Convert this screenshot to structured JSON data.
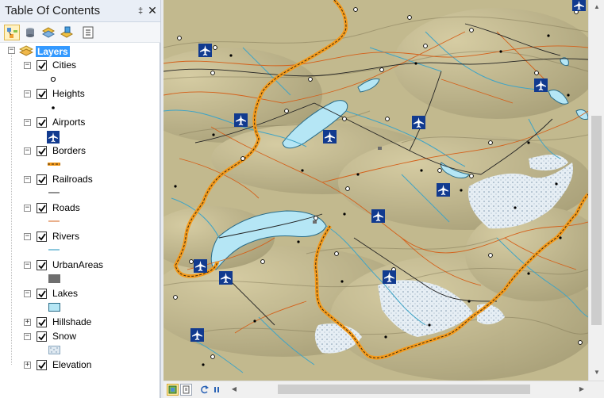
{
  "toc": {
    "title": "Table Of Contents",
    "pin_glyph": "‡",
    "close_glyph": "✕",
    "toolbar": [
      {
        "name": "list-by-drawing-order-icon",
        "active": true
      },
      {
        "name": "list-by-source-icon",
        "active": false
      },
      {
        "name": "list-by-visibility-icon",
        "active": false
      },
      {
        "name": "list-by-selection-icon",
        "active": false
      },
      {
        "name": "options-icon",
        "active": false
      }
    ],
    "root": {
      "label": "Layers",
      "expander": "−"
    },
    "layers": [
      {
        "label": "Cities",
        "expander": "−",
        "checked": true,
        "expanded": true,
        "symbol": "city-point-icon"
      },
      {
        "label": "Heights",
        "expander": "−",
        "checked": true,
        "expanded": true,
        "symbol": "height-point-icon"
      },
      {
        "label": "Airports",
        "expander": "−",
        "checked": true,
        "expanded": true,
        "symbol": "airport-icon"
      },
      {
        "label": "Borders",
        "expander": "−",
        "checked": true,
        "expanded": true,
        "symbol": "border-line-icon"
      },
      {
        "label": "Railroads",
        "expander": "−",
        "checked": true,
        "expanded": true,
        "symbol": "railroad-line-icon"
      },
      {
        "label": "Roads",
        "expander": "−",
        "checked": true,
        "expanded": true,
        "symbol": "road-line-icon"
      },
      {
        "label": "Rivers",
        "expander": "−",
        "checked": true,
        "expanded": true,
        "symbol": "river-line-icon"
      },
      {
        "label": "UrbanAreas",
        "expander": "−",
        "checked": true,
        "expanded": true,
        "symbol": "urban-area-fill-icon"
      },
      {
        "label": "Lakes",
        "expander": "−",
        "checked": true,
        "expanded": true,
        "symbol": "lake-fill-icon"
      },
      {
        "label": "Hillshade",
        "expander": "+",
        "checked": true,
        "expanded": false,
        "symbol": ""
      },
      {
        "label": "Snow",
        "expander": "−",
        "checked": true,
        "expanded": true,
        "symbol": "snow-fill-icon"
      },
      {
        "label": "Elevation",
        "expander": "+",
        "checked": true,
        "expanded": false,
        "symbol": ""
      }
    ]
  },
  "colors": {
    "selection": "#3399ff",
    "border": "#f59a1a",
    "border_dark": "#3a2a10",
    "road": "#d4601a",
    "railroad": "#222222",
    "river": "#3fa4c6",
    "lake": "#b5e6f5",
    "urban": "#6e6e6e",
    "snow": "#dfe9f1",
    "airport_bg": "#113a8f",
    "terrain": "#c2b98e"
  },
  "view_buttons": [
    {
      "name": "data-view-button",
      "active": true
    },
    {
      "name": "layout-view-button",
      "active": false
    },
    {
      "name": "refresh-button",
      "active": false
    },
    {
      "name": "pause-drawing-button",
      "active": false
    }
  ]
}
